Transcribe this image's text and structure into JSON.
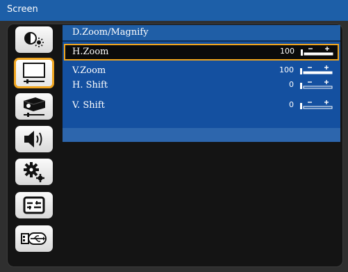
{
  "window": {
    "title": "Screen"
  },
  "sidebar": {
    "items": [
      {
        "icon": "brightness-contrast-icon",
        "active": false
      },
      {
        "icon": "screen-display-icon",
        "active": true
      },
      {
        "icon": "projector-settings-icon",
        "active": false
      },
      {
        "icon": "volume-speaker-icon",
        "active": false
      },
      {
        "icon": "gears-settings-icon",
        "active": false
      },
      {
        "icon": "options-panel-icon",
        "active": false
      },
      {
        "icon": "usb-connection-icon",
        "active": false
      }
    ]
  },
  "menu": {
    "title": "D.Zoom/Magnify",
    "items": [
      {
        "label": "H.Zoom",
        "value": "100",
        "level": 1.0,
        "selected": true
      },
      {
        "label": "V.Zoom",
        "value": "100",
        "level": 1.0,
        "selected": false
      },
      {
        "label": "H. Shift",
        "value": "0",
        "level": 0.0,
        "selected": false
      },
      {
        "label": "V. Shift",
        "value": "0",
        "level": 0.0,
        "selected": false
      }
    ]
  },
  "colors": {
    "accent": "#f0a51f",
    "menu_bg": "#1450a0",
    "title_bg": "#1d5fa8"
  }
}
